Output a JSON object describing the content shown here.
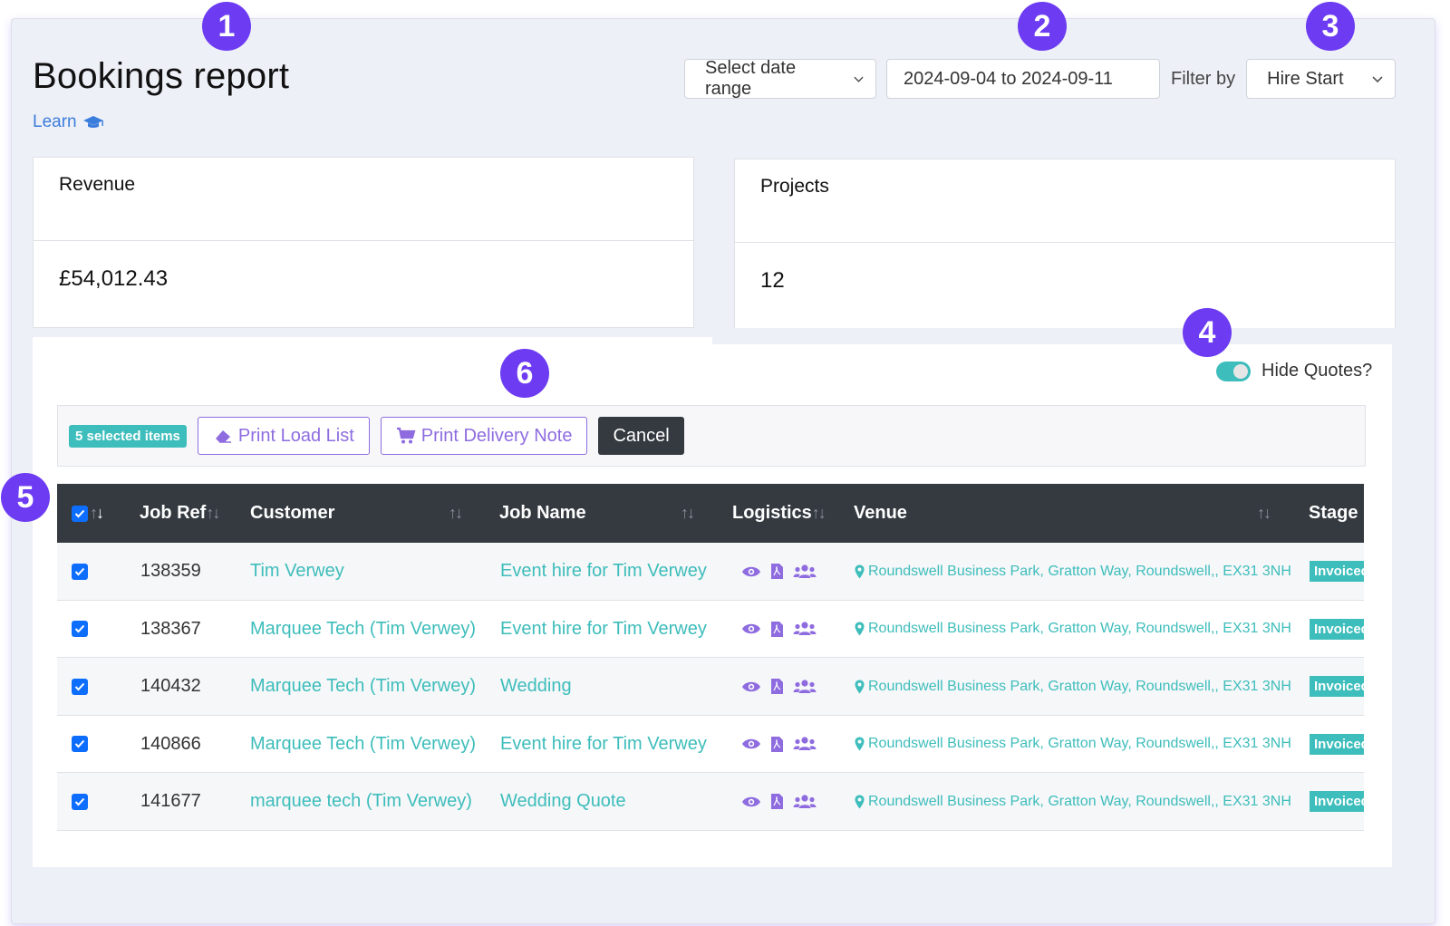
{
  "page": {
    "title": "Bookings report",
    "learn_label": "Learn"
  },
  "filters": {
    "date_range_select": "Select date range",
    "date_range_value": "2024-09-04 to 2024-09-11",
    "filter_by_label": "Filter by",
    "filter_by_value": "Hire Start"
  },
  "cards": {
    "revenue": {
      "label": "Revenue",
      "value": "£54,012.43"
    },
    "projects": {
      "label": "Projects",
      "value": "12"
    }
  },
  "toggle": {
    "label": "Hide Quotes?",
    "on": true
  },
  "actions": {
    "selected_badge": "5 selected items",
    "print_load_list": "Print Load List",
    "print_delivery_note": "Print Delivery Note",
    "cancel": "Cancel"
  },
  "table": {
    "columns": [
      "Job Ref",
      "Customer",
      "Job Name",
      "Logistics",
      "Venue",
      "Stage"
    ],
    "rows": [
      {
        "ref": "138359",
        "customer": "Tim Verwey",
        "job": "Event hire for Tim Verwey",
        "venue": "Roundswell Business Park, Gratton Way, Roundswell,, EX31 3NH",
        "stage": "Invoiced",
        "checked": true
      },
      {
        "ref": "138367",
        "customer": "Marquee Tech (Tim Verwey)",
        "job": "Event hire for Tim Verwey",
        "venue": "Roundswell Business Park, Gratton Way, Roundswell,, EX31 3NH",
        "stage": "Invoiced",
        "checked": true
      },
      {
        "ref": "140432",
        "customer": "Marquee Tech (Tim Verwey)",
        "job": "Wedding",
        "venue": "Roundswell Business Park, Gratton Way, Roundswell,, EX31 3NH",
        "stage": "Invoiced",
        "checked": true
      },
      {
        "ref": "140866",
        "customer": "Marquee Tech (Tim Verwey)",
        "job": "Event hire for Tim Verwey",
        "venue": "Roundswell Business Park, Gratton Way, Roundswell,, EX31 3NH",
        "stage": "Invoiced",
        "checked": true
      },
      {
        "ref": "141677",
        "customer": "marquee tech (Tim Verwey)",
        "job": "Wedding Quote",
        "venue": "Roundswell Business Park, Gratton Way, Roundswell,, EX31 3NH",
        "stage": "Invoiced",
        "checked": true
      }
    ]
  },
  "markers": [
    "1",
    "2",
    "3",
    "4",
    "5",
    "6"
  ],
  "colors": {
    "accent_teal": "#3dbdbb",
    "accent_purple": "#8e6ce0",
    "marker": "#6c3bf2",
    "header_dark": "#343a40"
  },
  "icons": [
    "graduation-cap-icon",
    "chevron-down-icon",
    "eraser-icon",
    "cart-icon",
    "eye-icon",
    "pdf-file-icon",
    "users-icon",
    "map-pin-icon",
    "sort-icon",
    "check-icon"
  ]
}
